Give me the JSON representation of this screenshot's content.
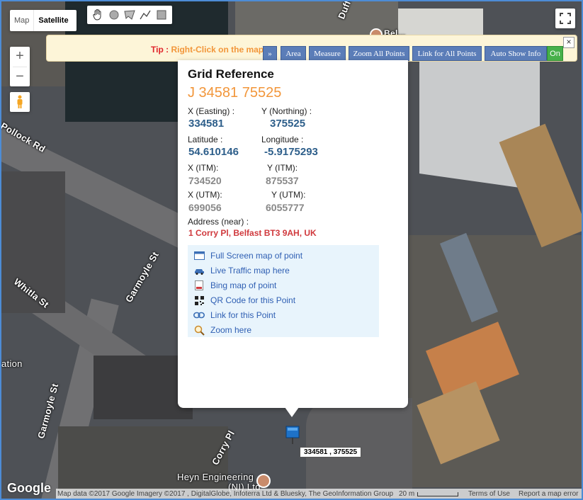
{
  "map_type": {
    "map_label": "Map",
    "satellite_label": "Satellite",
    "selected": "Satellite"
  },
  "draw_tools": [
    "hand-icon",
    "circle-icon",
    "polygon-icon",
    "polyline-icon",
    "rectangle-icon"
  ],
  "zoom": {
    "in": "+",
    "out": "−"
  },
  "tipbar": {
    "tip_label": "Tip :",
    "tip_text": "Right-Click on the map",
    "buttons": {
      "collapse": "»",
      "area": "Area",
      "measure": "Measure",
      "zoom_all": "Zoom All Points",
      "link_all": "Link for All Points",
      "auto_show": "Auto Show Info",
      "on": "On"
    },
    "close": "×"
  },
  "street_labels": {
    "dufferin": "Dufferin",
    "belfast_poi": "Bel...",
    "pollock": "Pollock Rd",
    "garmoyle1": "Garmoyle St",
    "whitla": "Whitla St",
    "garmoyle2": "Garmoyle St",
    "station": "ation",
    "corry": "Corry Pl",
    "heyn1": "Heyn Engineering",
    "heyn2": "(NI) Ltd"
  },
  "popup": {
    "title": "Grid Reference",
    "grid_ref": "J 34581 75525",
    "easting_label": "X (Easting) :",
    "easting": "334581",
    "northing_label": "Y (Northing) :",
    "northing": "375525",
    "lat_label": "Latitude :",
    "lat": "54.610146",
    "lon_label": "Longitude :",
    "lon": "-5.9175293",
    "itm_x_label": "X (ITM):",
    "itm_x": "734520",
    "itm_y_label": "Y (ITM):",
    "itm_y": "875537",
    "utm_x_label": "X (UTM):",
    "utm_x": "699056",
    "utm_y_label": "Y (UTM):",
    "utm_y": "6055777",
    "address_label": "Address (near) :",
    "address": "1 Corry Pl, Belfast BT3 9AH, UK",
    "links": [
      {
        "icon": "window-icon",
        "label": "Full Screen map of point"
      },
      {
        "icon": "car-icon",
        "label": "Live Traffic map here"
      },
      {
        "icon": "document-icon",
        "label": "Bing map of point"
      },
      {
        "icon": "qr-code-icon",
        "label": "QR Code for this Point"
      },
      {
        "icon": "link-icon",
        "label": "Link for this Point"
      },
      {
        "icon": "magnifier-icon",
        "label": "Zoom here"
      }
    ]
  },
  "marker": {
    "label": "334581 , 375525"
  },
  "footer": {
    "logo": "Google",
    "attribution": "Map data ©2017 Google Imagery ©2017 , DigitalGlobe, Infoterra Ltd & Bluesky, The GeoInformation Group",
    "scale": "20 m",
    "terms": "Terms of Use",
    "report": "Report a map error"
  }
}
